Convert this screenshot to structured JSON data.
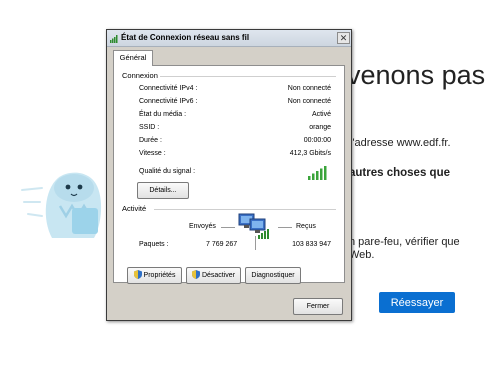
{
  "background": {
    "heading": "venons pas",
    "line_address": "l'adresse www.edf.fr.",
    "line_bold": "autres choses que",
    "line_firewall_1": "n pare-feu, vérifier que",
    "line_firewall_2": "Web.",
    "retry_label": "Réessayer",
    "retry_color": "#0a6fd1"
  },
  "dialog": {
    "title": "État de Connexion réseau sans fil",
    "close_label": "✕",
    "tab_label": "Général",
    "connection": {
      "group_title": "Connexion",
      "rows": [
        {
          "label": "Connectivité IPv4 :",
          "value": "Non connecté"
        },
        {
          "label": "Connectivité IPv6 :",
          "value": "Non connecté"
        },
        {
          "label": "État du média :",
          "value": "Activé"
        },
        {
          "label": "SSID :",
          "value": "orange"
        },
        {
          "label": "Durée :",
          "value": "00:00:00"
        },
        {
          "label": "Vitesse :",
          "value": "412,3 Gbits/s"
        }
      ],
      "signal_label": "Qualité du signal :",
      "signal_bars": 5,
      "details_button": "Détails..."
    },
    "activity": {
      "group_title": "Activité",
      "sent_label": "Envoyés",
      "received_label": "Reçus",
      "packets_label": "Paquets :",
      "packets_sent": "7 769 267",
      "packets_received": "103 833 947"
    },
    "buttons": {
      "properties": "Propriétés",
      "disable": "Désactiver",
      "diagnose": "Diagnostiquer",
      "close": "Fermer"
    }
  }
}
